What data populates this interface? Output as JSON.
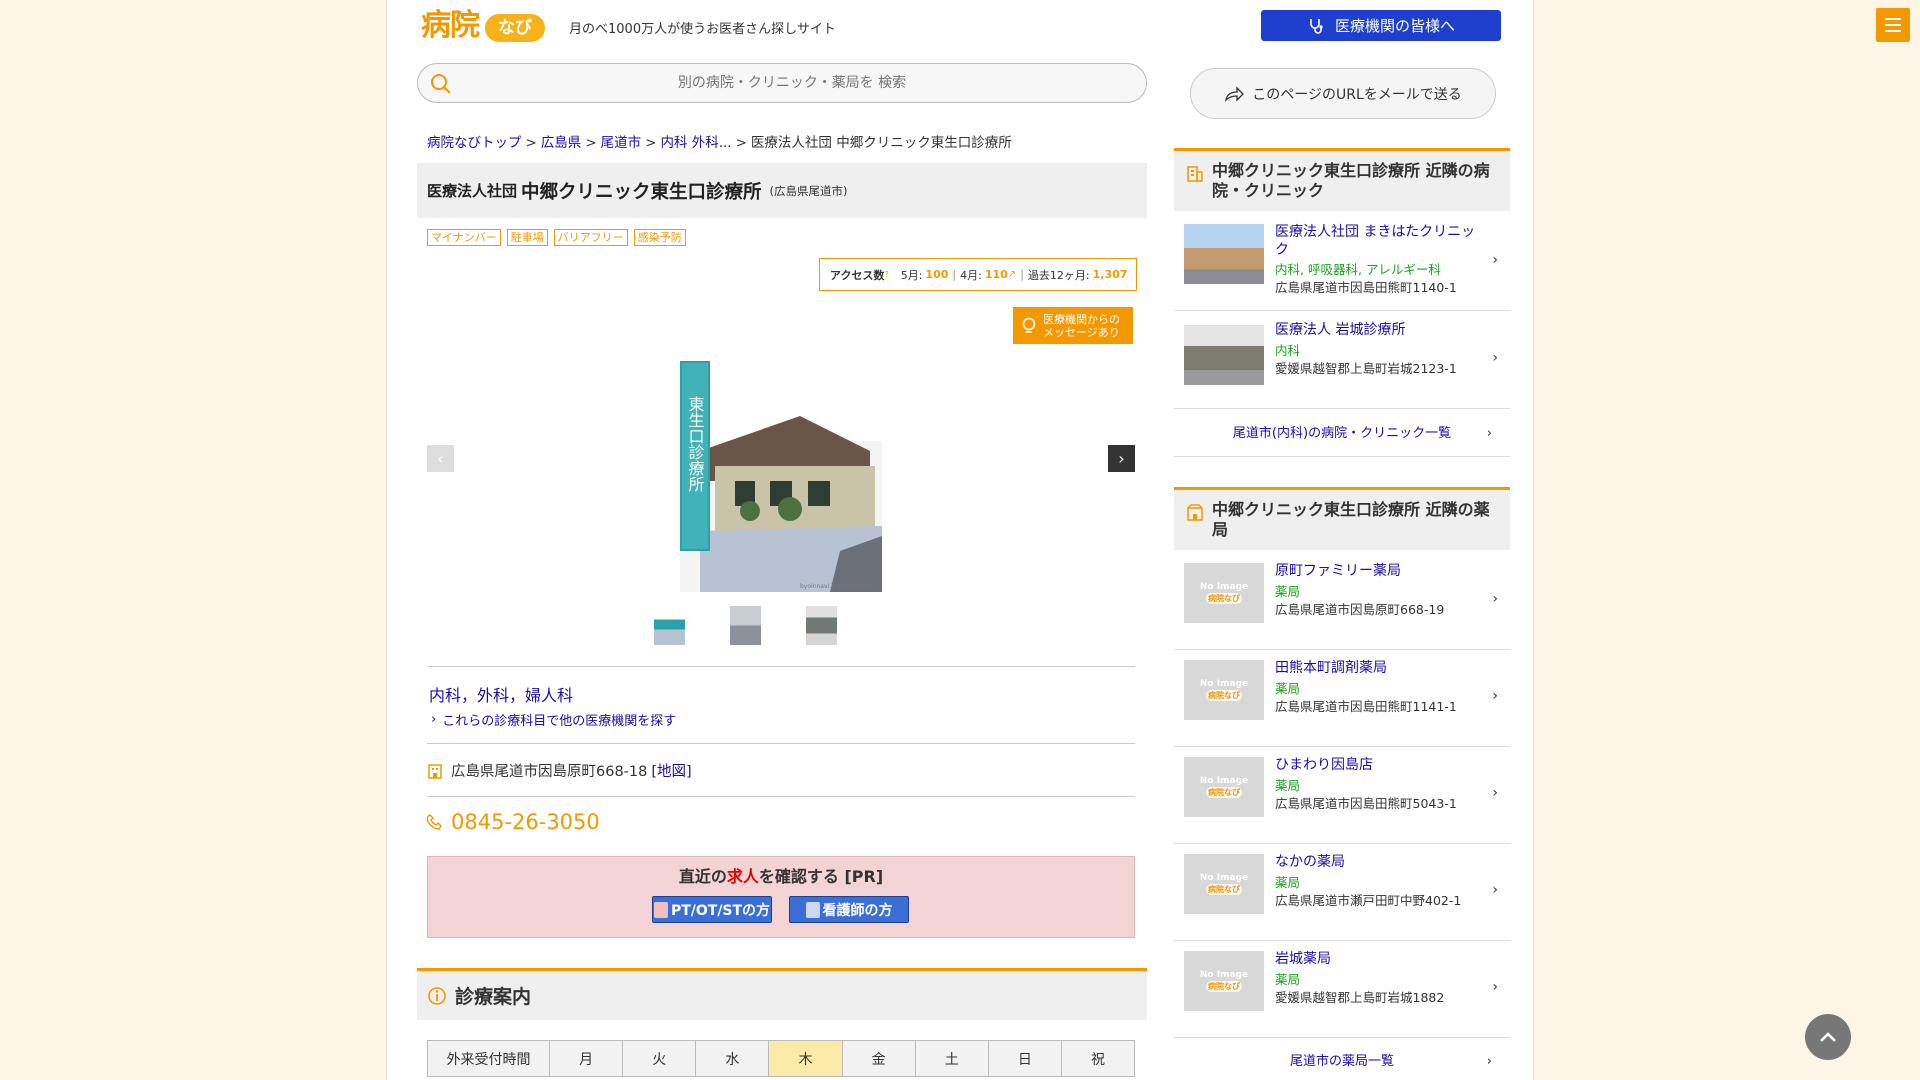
{
  "header": {
    "logo_main": "病院",
    "logo_sub": "なび",
    "tagline": "月のべ1000万人が使うお医者さん探しサイト",
    "institution_button": "医療機関の皆様へ"
  },
  "search": {
    "placeholder": "別の病院・クリニック・薬局を 検索"
  },
  "share": {
    "label": "このページのURLをメールで送る"
  },
  "breadcrumb": {
    "items": [
      "病院なびトップ",
      "広島県",
      "尾道市",
      "内科 外科..."
    ],
    "current": "医療法人社団 中郷クリニック東生口診療所",
    "separator": ">"
  },
  "title": {
    "corp": "医療法人社団",
    "name": "中郷クリニック東生口診療所",
    "location": "(広島県尾道市)"
  },
  "tags": [
    "マイナンバー",
    "駐車場",
    "バリアフリー",
    "感染予防"
  ],
  "access": {
    "label": "アクセス数",
    "may_label": "5月:",
    "may": "100",
    "apr_label": "4月:",
    "apr": "110",
    "year_label": "過去12ヶ月:",
    "year": "1,307"
  },
  "message_button": {
    "line1": "医療機関からの",
    "line2": "メッセージあり"
  },
  "photo": {
    "caption": "東生口診療所",
    "watermark": "byoinnavi.jp/photo/803?"
  },
  "departments": {
    "text": "内科，外科，婦人科",
    "search_link": "これらの診療科目で他の医療機関を探す"
  },
  "address": {
    "text": "広島県尾道市因島原町668-18",
    "map_link": "[地図]"
  },
  "phone": "0845-26-3050",
  "jobs": {
    "prefix": "直近の",
    "highlight": "求人",
    "suffix": "を確認する [PR]",
    "button1": "PT/OT/STの方",
    "button2": "看護師の方"
  },
  "schedule": {
    "heading": "診療案内",
    "columns": [
      "外来受付時間",
      "月",
      "火",
      "水",
      "木",
      "金",
      "土",
      "日",
      "祝"
    ],
    "highlight_col": "木"
  },
  "sidebar": {
    "clinics_heading": "中郷クリニック東生口診療所 近隣の病院・クリニック",
    "clinics": [
      {
        "name": "医療法人社団 まきはたクリニック",
        "type": "内科, 呼吸器科, アレルギー科",
        "address": "広島県尾道市因島田熊町1140-1"
      },
      {
        "name": "医療法人 岩城診療所",
        "type": "内科",
        "address": "愛媛県越智郡上島町岩城2123-1"
      }
    ],
    "clinics_link": "尾道市(内科)の病院・クリニック一覧",
    "pharmacy_heading": "中郷クリニック東生口診療所 近隣の薬局",
    "noimage": {
      "line1": "No Image",
      "line2": "病院なび"
    },
    "pharmacies": [
      {
        "name": "原町ファミリー薬局",
        "type": "薬局",
        "address": "広島県尾道市因島原町668-19"
      },
      {
        "name": "田熊本町調剤薬局",
        "type": "薬局",
        "address": "広島県尾道市因島田熊町1141-1"
      },
      {
        "name": "ひまわり因島店",
        "type": "薬局",
        "address": "広島県尾道市因島田熊町5043-1"
      },
      {
        "name": "なかの薬局",
        "type": "薬局",
        "address": "広島県尾道市瀬戸田町中野402-1"
      },
      {
        "name": "岩城薬局",
        "type": "薬局",
        "address": "愛媛県越智郡上島町岩城1882"
      }
    ],
    "pharmacy_link": "尾道市の薬局一覧"
  },
  "colors": {
    "accent": "#f39800",
    "link": "#1a0dab",
    "institution_button": "#1f3fcf",
    "jobs_bg": "#f3d3d3"
  }
}
